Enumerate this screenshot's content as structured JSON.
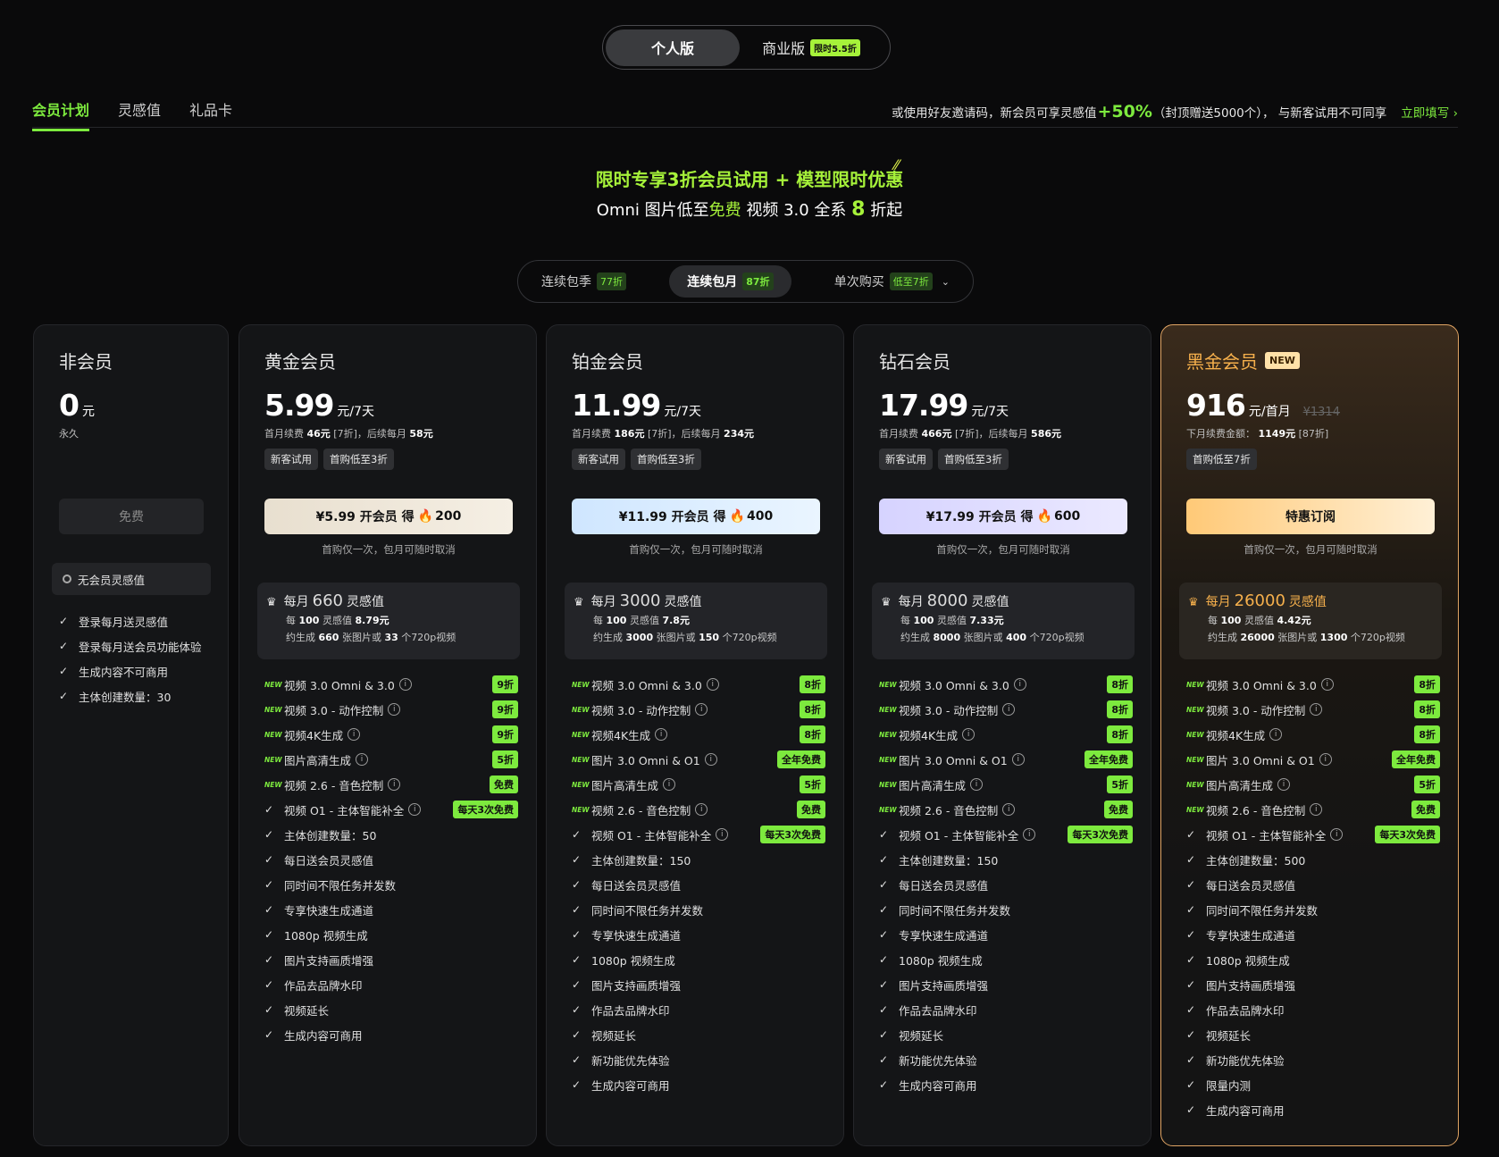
{
  "edition": {
    "personal": "个人版",
    "business": "商业版",
    "business_badge": "限时5.5折"
  },
  "tabs": [
    "会员计划",
    "灵感值",
    "礼品卡"
  ],
  "invite": {
    "prefix": "或使用好友邀请码，新会员可享灵感值",
    "pct": "+50%",
    "suffix": "（封顶赠送5000个）， 与新客试用不可同享",
    "link": "立即填写 ›"
  },
  "promo": {
    "line1": "限时专享3折会员试用 + 模型限时优惠",
    "line2_a": "Omni 图片低至",
    "line2_free": "免费",
    "line2_b": "  视频 3.0 全系 ",
    "line2_num": "8",
    "line2_c": " 折起"
  },
  "billing": [
    {
      "label": "连续包季",
      "badge": "77折"
    },
    {
      "label": "连续包月",
      "badge": "87折"
    },
    {
      "label": "单次购买",
      "badge": "低至7折"
    }
  ],
  "nonmember": {
    "title": "非会员",
    "price": "0",
    "unit": "元",
    "sub": "永久",
    "button": "免费",
    "box": "无会员灵感值",
    "features": [
      "登录每月送灵感值",
      "登录每月送会员功能体验",
      "生成内容不可商用",
      "主体创建数量：30"
    ]
  },
  "plans": [
    {
      "title": "黄金会员",
      "price": "5.99",
      "unit": "元/7天",
      "old": "",
      "sub_a": "首月续费 ",
      "sub_b": "46元",
      "sub_c": " [7折]，后续每月 ",
      "sub_d": "58元",
      "tags": [
        "新客试用",
        "首购低至3折"
      ],
      "btn_a": "¥5.99 开会员  得",
      "btn_b": "200",
      "note": "首购仅一次，包月可随时取消",
      "credits": "660",
      "per_a": "每 ",
      "per_b": "100",
      "per_c": " 灵感值 ",
      "per_d": "8.79元",
      "gen_a": "约生成 ",
      "gen_b": "660",
      "gen_c": " 张图片或 ",
      "gen_d": "33",
      "gen_e": " 个720p视频",
      "features": [
        {
          "t": "视频 3.0 Omni & 3.0",
          "new": true,
          "info": true,
          "badge": "9折"
        },
        {
          "t": "视频 3.0 - 动作控制",
          "new": true,
          "info": true,
          "badge": "9折"
        },
        {
          "t": "视频4K生成",
          "new": true,
          "info": true,
          "badge": "9折"
        },
        {
          "t": "图片高清生成",
          "new": true,
          "info": true,
          "badge": "5折"
        },
        {
          "t": "视频 2.6 - 音色控制",
          "new": true,
          "info": true,
          "badge": "免费"
        },
        {
          "t": "视频 O1 - 主体智能补全",
          "info": true,
          "badge": "每天3次免费"
        },
        {
          "t": "主体创建数量：50"
        },
        {
          "t": "每日送会员灵感值"
        },
        {
          "t": "同时间不限任务并发数"
        },
        {
          "t": "专享快速生成通道"
        },
        {
          "t": "1080p 视频生成"
        },
        {
          "t": "图片支持画质增强"
        },
        {
          "t": "作品去品牌水印"
        },
        {
          "t": "视频延长"
        },
        {
          "t": "生成内容可商用"
        }
      ]
    },
    {
      "title": "铂金会员",
      "price": "11.99",
      "unit": "元/7天",
      "old": "",
      "sub_a": "首月续费 ",
      "sub_b": "186元",
      "sub_c": " [7折]，后续每月 ",
      "sub_d": "234元",
      "tags": [
        "新客试用",
        "首购低至3折"
      ],
      "btn_a": "¥11.99 开会员  得",
      "btn_b": "400",
      "note": "首购仅一次，包月可随时取消",
      "credits": "3000",
      "per_a": "每 ",
      "per_b": "100",
      "per_c": " 灵感值 ",
      "per_d": "7.8元",
      "gen_a": "约生成 ",
      "gen_b": "3000",
      "gen_c": " 张图片或 ",
      "gen_d": "150",
      "gen_e": " 个720p视频",
      "features": [
        {
          "t": "视频 3.0 Omni & 3.0",
          "new": true,
          "info": true,
          "badge": "8折"
        },
        {
          "t": "视频 3.0 - 动作控制",
          "new": true,
          "info": true,
          "badge": "8折"
        },
        {
          "t": "视频4K生成",
          "new": true,
          "info": true,
          "badge": "8折"
        },
        {
          "t": "图片 3.0 Omni & O1",
          "new": true,
          "info": true,
          "badge": "全年免费"
        },
        {
          "t": "图片高清生成",
          "new": true,
          "info": true,
          "badge": "5折"
        },
        {
          "t": "视频 2.6 - 音色控制",
          "new": true,
          "info": true,
          "badge": "免费"
        },
        {
          "t": "视频 O1 - 主体智能补全",
          "info": true,
          "badge": "每天3次免费"
        },
        {
          "t": "主体创建数量：150"
        },
        {
          "t": "每日送会员灵感值"
        },
        {
          "t": "同时间不限任务并发数"
        },
        {
          "t": "专享快速生成通道"
        },
        {
          "t": "1080p 视频生成"
        },
        {
          "t": "图片支持画质增强"
        },
        {
          "t": "作品去品牌水印"
        },
        {
          "t": "视频延长"
        },
        {
          "t": "新功能优先体验"
        },
        {
          "t": "生成内容可商用"
        }
      ]
    },
    {
      "title": "钻石会员",
      "price": "17.99",
      "unit": "元/7天",
      "old": "",
      "sub_a": "首月续费 ",
      "sub_b": "466元",
      "sub_c": " [7折]，后续每月 ",
      "sub_d": "586元",
      "tags": [
        "新客试用",
        "首购低至3折"
      ],
      "btn_a": "¥17.99 开会员  得",
      "btn_b": "600",
      "note": "首购仅一次，包月可随时取消",
      "credits": "8000",
      "per_a": "每 ",
      "per_b": "100",
      "per_c": " 灵感值 ",
      "per_d": "7.33元",
      "gen_a": "约生成 ",
      "gen_b": "8000",
      "gen_c": " 张图片或 ",
      "gen_d": "400",
      "gen_e": " 个720p视频",
      "features": [
        {
          "t": "视频 3.0 Omni & 3.0",
          "new": true,
          "info": true,
          "badge": "8折"
        },
        {
          "t": "视频 3.0 - 动作控制",
          "new": true,
          "info": true,
          "badge": "8折"
        },
        {
          "t": "视频4K生成",
          "new": true,
          "info": true,
          "badge": "8折"
        },
        {
          "t": "图片 3.0 Omni & O1",
          "new": true,
          "info": true,
          "badge": "全年免费"
        },
        {
          "t": "图片高清生成",
          "new": true,
          "info": true,
          "badge": "5折"
        },
        {
          "t": "视频 2.6 - 音色控制",
          "new": true,
          "info": true,
          "badge": "免费"
        },
        {
          "t": "视频 O1 - 主体智能补全",
          "info": true,
          "badge": "每天3次免费"
        },
        {
          "t": "主体创建数量：150"
        },
        {
          "t": "每日送会员灵感值"
        },
        {
          "t": "同时间不限任务并发数"
        },
        {
          "t": "专享快速生成通道"
        },
        {
          "t": "1080p 视频生成"
        },
        {
          "t": "图片支持画质增强"
        },
        {
          "t": "作品去品牌水印"
        },
        {
          "t": "视频延长"
        },
        {
          "t": "新功能优先体验"
        },
        {
          "t": "生成内容可商用"
        }
      ]
    },
    {
      "title": "黑金会员",
      "new_badge": "NEW",
      "price": "916",
      "unit": "元/首月",
      "old": "¥1314",
      "sub_a": "下月续费金额： ",
      "sub_b": "1149元",
      "sub_c": " [87折]",
      "sub_d": "",
      "tags": [
        "首购低至7折"
      ],
      "btn_a": "特惠订阅",
      "btn_b": "",
      "note": "首购仅一次，包月可随时取消",
      "credits": "26000",
      "per_a": "每 ",
      "per_b": "100",
      "per_c": " 灵感值 ",
      "per_d": "4.42元",
      "gen_a": "约生成 ",
      "gen_b": "26000",
      "gen_c": " 张图片或 ",
      "gen_d": "1300",
      "gen_e": " 个720p视频",
      "features": [
        {
          "t": "视频 3.0 Omni & 3.0",
          "new": true,
          "info": true,
          "badge": "8折"
        },
        {
          "t": "视频 3.0 - 动作控制",
          "new": true,
          "info": true,
          "badge": "8折"
        },
        {
          "t": "视频4K生成",
          "new": true,
          "info": true,
          "badge": "8折"
        },
        {
          "t": "图片 3.0 Omni & O1",
          "new": true,
          "info": true,
          "badge": "全年免费"
        },
        {
          "t": "图片高清生成",
          "new": true,
          "info": true,
          "badge": "5折"
        },
        {
          "t": "视频 2.6 - 音色控制",
          "new": true,
          "info": true,
          "badge": "免费"
        },
        {
          "t": "视频 O1 - 主体智能补全",
          "info": true,
          "badge": "每天3次免费"
        },
        {
          "t": "主体创建数量：500"
        },
        {
          "t": "每日送会员灵感值"
        },
        {
          "t": "同时间不限任务并发数"
        },
        {
          "t": "专享快速生成通道"
        },
        {
          "t": "1080p 视频生成"
        },
        {
          "t": "图片支持画质增强"
        },
        {
          "t": "作品去品牌水印"
        },
        {
          "t": "视频延长"
        },
        {
          "t": "新功能优先体验"
        },
        {
          "t": "限量内测"
        },
        {
          "t": "生成内容可商用"
        }
      ]
    }
  ],
  "labels": {
    "new": "NEW",
    "monthly": "每月",
    "credit_unit": "灵感值"
  },
  "colors": {
    "accent": "#7dea3e",
    "gold": "#f6b04c"
  }
}
